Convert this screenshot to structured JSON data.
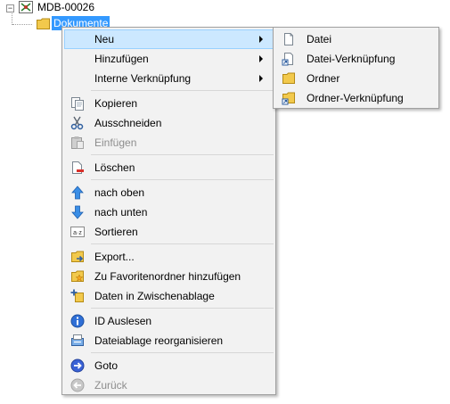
{
  "tree": {
    "root_label": "MDB-00026",
    "expander_glyph": "−",
    "child_label": "Dokumente",
    "selection_color": "#3399ff"
  },
  "context_menu": {
    "neu": "Neu",
    "hinzufuegen": "Hinzufügen",
    "interne_verknuepfung": "Interne Verknüpfung",
    "kopieren": "Kopieren",
    "ausschneiden": "Ausschneiden",
    "einfuegen": "Einfügen",
    "loeschen": "Löschen",
    "nach_oben": "nach oben",
    "nach_unten": "nach unten",
    "sortieren": "Sortieren",
    "export": "Export...",
    "zu_favoriten": "Zu Favoritenordner hinzufügen",
    "daten_zwischenablage": "Daten in Zwischenablage",
    "id_auslesen": "ID Auslesen",
    "dateiablage": "Dateiablage reorganisieren",
    "goto": "Goto",
    "zurueck": "Zurück",
    "highlight_color": "#cce8ff",
    "disabled_items": [
      "Einfügen",
      "Zurück"
    ]
  },
  "submenu": {
    "datei": "Datei",
    "datei_verknuepfung": "Datei-Verknüpfung",
    "ordner": "Ordner",
    "ordner_verknuepfung": "Ordner-Verknüpfung"
  },
  "icons": {
    "sortieren_glyph": "a·z"
  }
}
